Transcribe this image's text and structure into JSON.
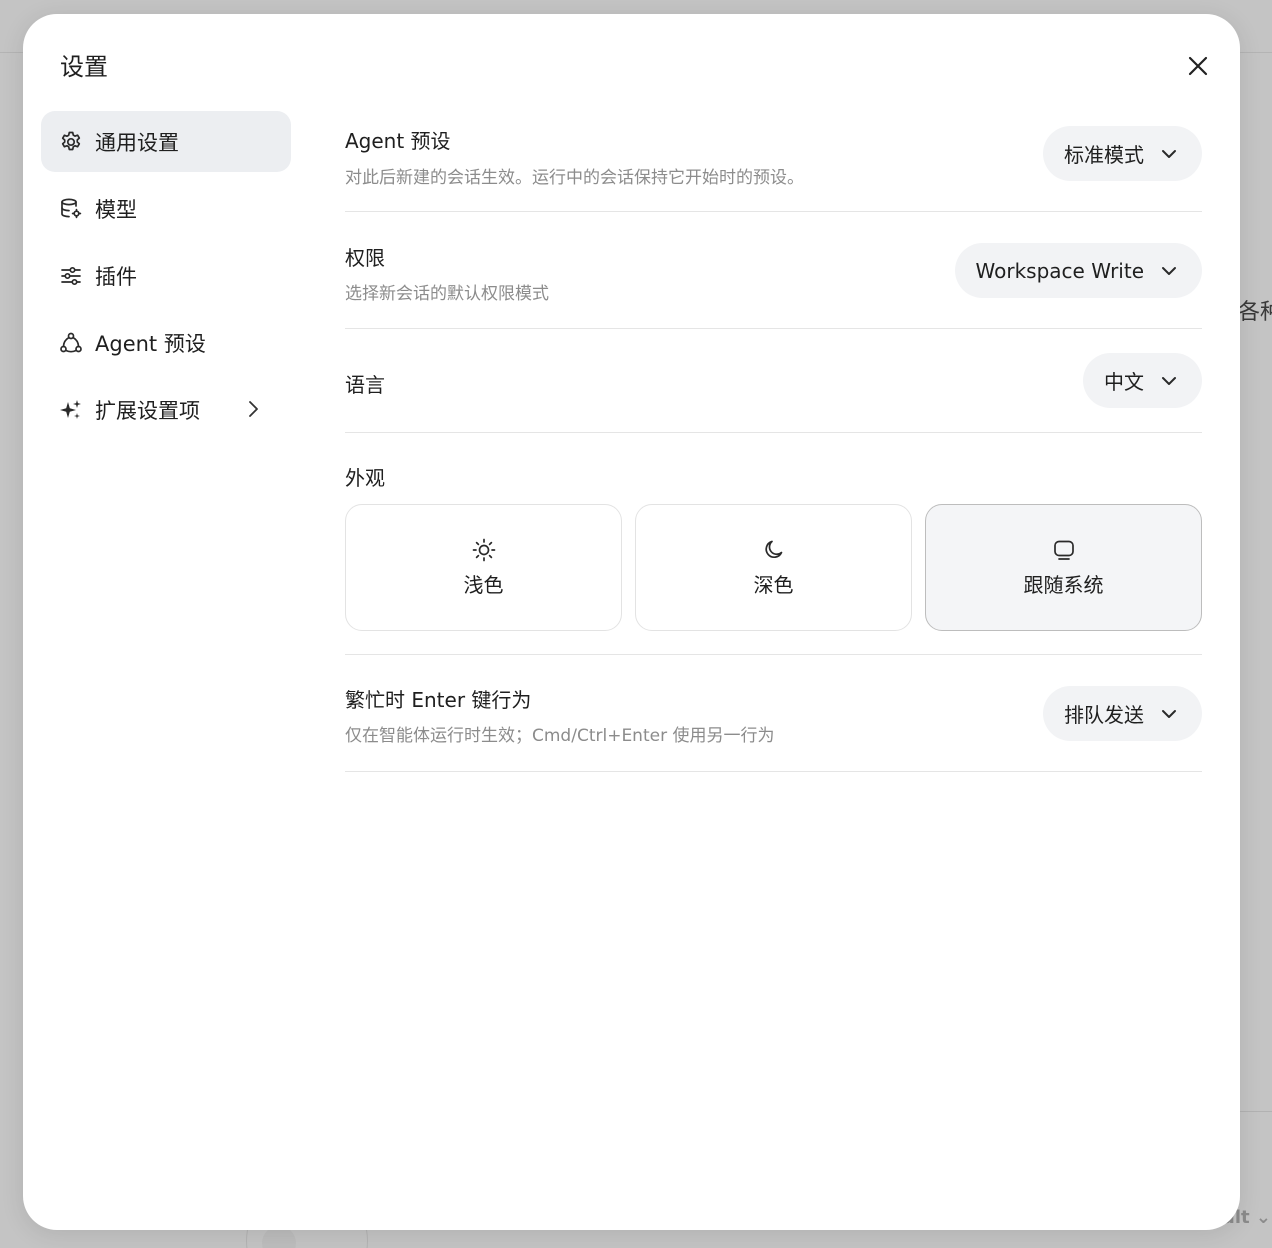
{
  "background": {
    "peek_text": "各种",
    "peek_bottom_text": "ult ⌄"
  },
  "modal": {
    "title": "设置",
    "close_icon": "close-icon"
  },
  "sidebar": {
    "items": [
      {
        "label": "通用设置",
        "icon": "gear-icon",
        "active": true
      },
      {
        "label": "模型",
        "icon": "database-gear-icon",
        "active": false
      },
      {
        "label": "插件",
        "icon": "sliders-icon",
        "active": false
      },
      {
        "label": "Agent 预设",
        "icon": "agent-network-icon",
        "active": false
      },
      {
        "label": "扩展设置项",
        "icon": "sparkles-icon",
        "active": false,
        "has_submenu": true
      }
    ]
  },
  "settings": {
    "agent_preset": {
      "title": "Agent 预设",
      "description": "对此后新建的会话生效。运行中的会话保持它开始时的预设。",
      "value": "标准模式"
    },
    "permission": {
      "title": "权限",
      "description": "选择新会话的默认权限模式",
      "value": "Workspace Write"
    },
    "language": {
      "title": "语言",
      "value": "中文"
    },
    "appearance": {
      "title": "外观",
      "options": [
        {
          "label": "浅色",
          "icon": "sun-icon",
          "selected": false
        },
        {
          "label": "深色",
          "icon": "moon-icon",
          "selected": false
        },
        {
          "label": "跟随系统",
          "icon": "monitor-icon",
          "selected": true
        }
      ]
    },
    "busy_enter": {
      "title": "繁忙时 Enter 键行为",
      "description": "仅在智能体运行时生效；Cmd/Ctrl+Enter 使用另一行为",
      "value": "排队发送"
    }
  },
  "colors": {
    "active_nav_bg": "#eceef1",
    "select_bg": "#f2f3f5",
    "muted_text": "#8c8c8c",
    "text": "#1f1f1f"
  }
}
